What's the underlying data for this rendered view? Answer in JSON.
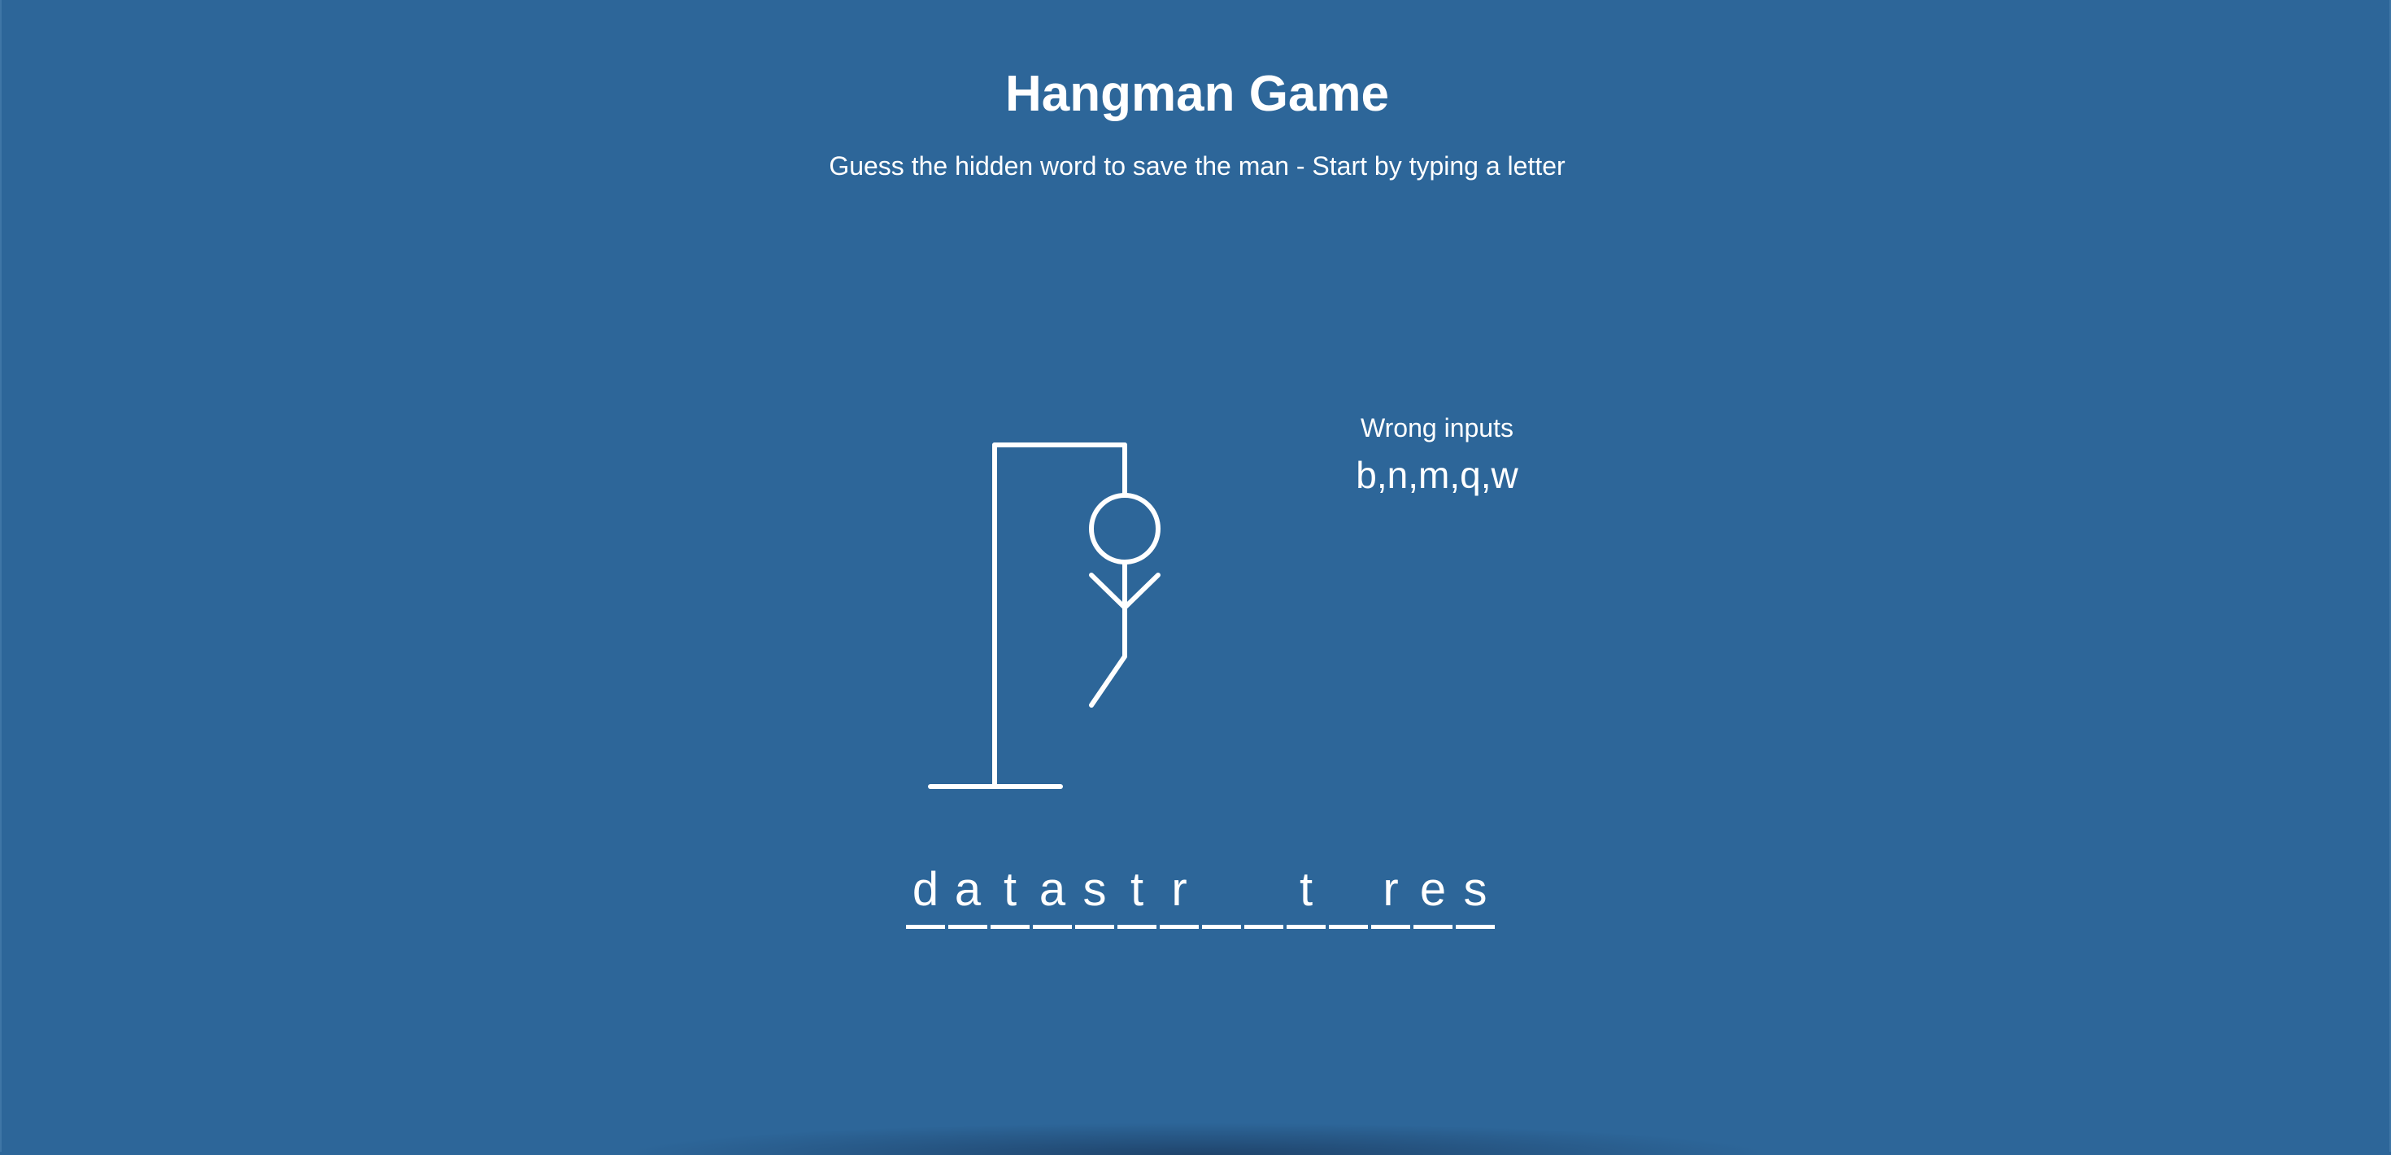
{
  "header": {
    "title": "Hangman Game",
    "subtitle": "Guess the hidden word to save the man - Start by typing a letter"
  },
  "wrong_inputs": {
    "label": "Wrong inputs",
    "letters": "b,n,m,q,w"
  },
  "word": {
    "slots": [
      "d",
      "a",
      "t",
      "a",
      "s",
      "t",
      "r",
      "",
      "",
      "t",
      "",
      "r",
      "e",
      "s"
    ]
  },
  "hangman": {
    "parts_shown": [
      "head",
      "body",
      "left-arm",
      "right-arm",
      "left-leg"
    ],
    "color": "#ffffff"
  },
  "theme": {
    "background": "#2d6699",
    "foreground": "#ffffff"
  }
}
